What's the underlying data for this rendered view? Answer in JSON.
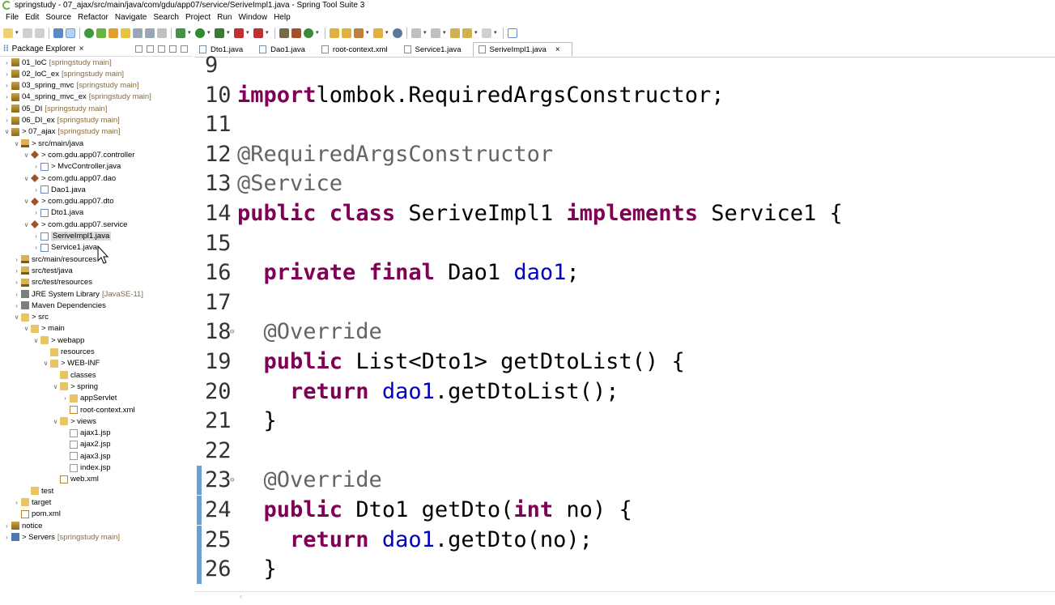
{
  "window": {
    "title": "springstudy - 07_ajax/src/main/java/com/gdu/app07/service/SeriveImpl1.java - Spring Tool Suite 3"
  },
  "menu": [
    "File",
    "Edit",
    "Source",
    "Refactor",
    "Navigate",
    "Search",
    "Project",
    "Run",
    "Window",
    "Help"
  ],
  "explorer": {
    "title": "Package Explorer",
    "nodes": [
      {
        "label": "01_IoC",
        "suffix": "[springstudy main]",
        "depth": 0,
        "tw": "›",
        "icon": "project"
      },
      {
        "label": "02_IoC_ex",
        "suffix": "[springstudy main]",
        "depth": 0,
        "tw": "›",
        "icon": "project"
      },
      {
        "label": "03_spring_mvc",
        "suffix": "[springstudy main]",
        "depth": 0,
        "tw": "›",
        "icon": "project"
      },
      {
        "label": "04_spring_mvc_ex",
        "suffix": "[springstudy main]",
        "depth": 0,
        "tw": "›",
        "icon": "project"
      },
      {
        "label": "05_DI",
        "suffix": "[springstudy main]",
        "depth": 0,
        "tw": "›",
        "icon": "project"
      },
      {
        "label": "06_DI_ex",
        "suffix": "[springstudy main]",
        "depth": 0,
        "tw": "›",
        "icon": "project"
      },
      {
        "label": "> 07_ajax",
        "suffix": "[springstudy main]",
        "depth": 0,
        "tw": "∨",
        "icon": "project"
      },
      {
        "label": "> src/main/java",
        "suffix": "",
        "depth": 1,
        "tw": "∨",
        "icon": "srcfolder"
      },
      {
        "label": "> com.gdu.app07.controller",
        "suffix": "",
        "depth": 2,
        "tw": "∨",
        "icon": "package"
      },
      {
        "label": "> MvcController.java",
        "suffix": "",
        "depth": 3,
        "tw": "›",
        "icon": "java"
      },
      {
        "label": "> com.gdu.app07.dao",
        "suffix": "",
        "depth": 2,
        "tw": "∨",
        "icon": "package"
      },
      {
        "label": "Dao1.java",
        "suffix": "",
        "depth": 3,
        "tw": "›",
        "icon": "java"
      },
      {
        "label": "> com.gdu.app07.dto",
        "suffix": "",
        "depth": 2,
        "tw": "∨",
        "icon": "package"
      },
      {
        "label": "Dto1.java",
        "suffix": "",
        "depth": 3,
        "tw": "›",
        "icon": "java"
      },
      {
        "label": "> com.gdu.app07.service",
        "suffix": "",
        "depth": 2,
        "tw": "∨",
        "icon": "package"
      },
      {
        "label": "SeriveImpl1.java",
        "suffix": "",
        "depth": 3,
        "tw": "›",
        "icon": "java",
        "selected": true
      },
      {
        "label": "Service1.java",
        "suffix": "",
        "depth": 3,
        "tw": "›",
        "icon": "java"
      },
      {
        "label": "src/main/resources",
        "suffix": "",
        "depth": 1,
        "tw": "›",
        "icon": "srcfolder"
      },
      {
        "label": "src/test/java",
        "suffix": "",
        "depth": 1,
        "tw": "›",
        "icon": "srcfolder"
      },
      {
        "label": "src/test/resources",
        "suffix": "",
        "depth": 1,
        "tw": "›",
        "icon": "srcfolder"
      },
      {
        "label": "JRE System Library",
        "suffix": "[JavaSE-11]",
        "depth": 1,
        "tw": "›",
        "icon": "lib"
      },
      {
        "label": "Maven Dependencies",
        "suffix": "",
        "depth": 1,
        "tw": "›",
        "icon": "lib"
      },
      {
        "label": "> src",
        "suffix": "",
        "depth": 1,
        "tw": "∨",
        "icon": "folder"
      },
      {
        "label": "> main",
        "suffix": "",
        "depth": 2,
        "tw": "∨",
        "icon": "folder"
      },
      {
        "label": "> webapp",
        "suffix": "",
        "depth": 3,
        "tw": "∨",
        "icon": "folder"
      },
      {
        "label": "resources",
        "suffix": "",
        "depth": 4,
        "tw": "",
        "icon": "folder"
      },
      {
        "label": "> WEB-INF",
        "suffix": "",
        "depth": 4,
        "tw": "∨",
        "icon": "folder"
      },
      {
        "label": "classes",
        "suffix": "",
        "depth": 5,
        "tw": "",
        "icon": "folder"
      },
      {
        "label": "> spring",
        "suffix": "",
        "depth": 5,
        "tw": "∨",
        "icon": "folder"
      },
      {
        "label": "appServlet",
        "suffix": "",
        "depth": 6,
        "tw": "›",
        "icon": "folder"
      },
      {
        "label": "root-context.xml",
        "suffix": "",
        "depth": 6,
        "tw": "",
        "icon": "xml"
      },
      {
        "label": "> views",
        "suffix": "",
        "depth": 5,
        "tw": "∨",
        "icon": "folder"
      },
      {
        "label": "ajax1.jsp",
        "suffix": "",
        "depth": 6,
        "tw": "",
        "icon": "file"
      },
      {
        "label": "ajax2.jsp",
        "suffix": "",
        "depth": 6,
        "tw": "",
        "icon": "file"
      },
      {
        "label": "ajax3.jsp",
        "suffix": "",
        "depth": 6,
        "tw": "",
        "icon": "file"
      },
      {
        "label": "index.jsp",
        "suffix": "",
        "depth": 6,
        "tw": "",
        "icon": "file"
      },
      {
        "label": "web.xml",
        "suffix": "",
        "depth": 5,
        "tw": "",
        "icon": "xml"
      },
      {
        "label": "test",
        "suffix": "",
        "depth": 2,
        "tw": "",
        "icon": "folder"
      },
      {
        "label": "target",
        "suffix": "",
        "depth": 1,
        "tw": "›",
        "icon": "folder"
      },
      {
        "label": "pom.xml",
        "suffix": "",
        "depth": 1,
        "tw": "",
        "icon": "xml"
      },
      {
        "label": "notice",
        "suffix": "",
        "depth": 0,
        "tw": "›",
        "icon": "project"
      },
      {
        "label": "> Servers",
        "suffix": "[springstudy main]",
        "depth": 0,
        "tw": "›",
        "icon": "server"
      }
    ]
  },
  "tabs": [
    {
      "label": "Dto1.java",
      "active": false
    },
    {
      "label": "Dao1.java",
      "active": false
    },
    {
      "label": "root-context.xml",
      "active": false
    },
    {
      "label": "Service1.java",
      "active": false
    },
    {
      "label": "SeriveImpl1.java",
      "active": true
    }
  ],
  "editor": {
    "lines": [
      {
        "num": "9",
        "tokens": []
      },
      {
        "num": "10",
        "tokens": [
          [
            "kw",
            "import"
          ],
          [
            "",
            "lombok.RequiredArgsConstructor;"
          ]
        ]
      },
      {
        "num": "11",
        "tokens": []
      },
      {
        "num": "12",
        "tokens": [
          [
            "ann",
            "@RequiredArgsConstructor"
          ]
        ]
      },
      {
        "num": "13",
        "tokens": [
          [
            "ann",
            "@Service"
          ]
        ]
      },
      {
        "num": "14",
        "tokens": [
          [
            "kw",
            "public"
          ],
          [
            "kw",
            " class"
          ],
          [
            "",
            " SeriveImpl1 "
          ],
          [
            "kw",
            "implements"
          ],
          [
            "",
            " Service1 {"
          ]
        ]
      },
      {
        "num": "15",
        "tokens": []
      },
      {
        "num": "16",
        "tokens": [
          [
            "",
            "  "
          ],
          [
            "kw",
            "private"
          ],
          [
            "kw",
            " final"
          ],
          [
            "",
            " Dao1 "
          ],
          [
            "fld",
            "dao1"
          ],
          [
            "",
            ";"
          ]
        ]
      },
      {
        "num": "17",
        "tokens": []
      },
      {
        "num": "18",
        "fold": "⊖",
        "tokens": [
          [
            "ann",
            "  @Override"
          ]
        ]
      },
      {
        "num": "19",
        "tokens": [
          [
            "",
            "  "
          ],
          [
            "kw",
            "public"
          ],
          [
            "",
            " List<Dto1> getDtoList() {"
          ]
        ]
      },
      {
        "num": "20",
        "tokens": [
          [
            "",
            "    "
          ],
          [
            "kw",
            "return"
          ],
          [
            "",
            " "
          ],
          [
            "fld",
            "dao1"
          ],
          [
            "",
            ".getDtoList();"
          ]
        ]
      },
      {
        "num": "21",
        "tokens": [
          [
            "",
            "  }"
          ]
        ]
      },
      {
        "num": "22",
        "tokens": []
      },
      {
        "num": "23",
        "fold": "⊖",
        "marker": true,
        "tokens": [
          [
            "ann",
            "  @Override"
          ]
        ]
      },
      {
        "num": "24",
        "marker": true,
        "tokens": [
          [
            "",
            "  "
          ],
          [
            "kw",
            "public"
          ],
          [
            "",
            " Dto1 getDto("
          ],
          [
            "kw",
            "int"
          ],
          [
            "",
            " no) {"
          ]
        ]
      },
      {
        "num": "25",
        "marker": true,
        "tokens": [
          [
            "",
            "    "
          ],
          [
            "kw",
            "return"
          ],
          [
            "",
            " "
          ],
          [
            "fld",
            "dao1"
          ],
          [
            "",
            ".getDto(no);"
          ]
        ]
      },
      {
        "num": "26",
        "marker": true,
        "tokens": [
          [
            "",
            "  }"
          ]
        ]
      }
    ]
  },
  "colors": {
    "keyword": "#7f0055",
    "annotation": "#646464",
    "field": "#0000c0",
    "selection": "#d9d9d9"
  }
}
